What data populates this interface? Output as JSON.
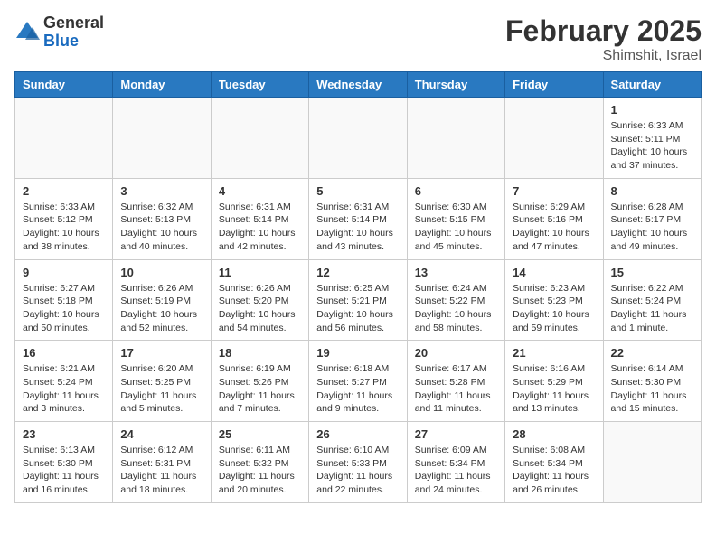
{
  "header": {
    "logo_general": "General",
    "logo_blue": "Blue",
    "main_title": "February 2025",
    "subtitle": "Shimshit, Israel"
  },
  "weekdays": [
    "Sunday",
    "Monday",
    "Tuesday",
    "Wednesday",
    "Thursday",
    "Friday",
    "Saturday"
  ],
  "weeks": [
    [
      {
        "day": "",
        "info": ""
      },
      {
        "day": "",
        "info": ""
      },
      {
        "day": "",
        "info": ""
      },
      {
        "day": "",
        "info": ""
      },
      {
        "day": "",
        "info": ""
      },
      {
        "day": "",
        "info": ""
      },
      {
        "day": "1",
        "info": "Sunrise: 6:33 AM\nSunset: 5:11 PM\nDaylight: 10 hours\nand 37 minutes."
      }
    ],
    [
      {
        "day": "2",
        "info": "Sunrise: 6:33 AM\nSunset: 5:12 PM\nDaylight: 10 hours\nand 38 minutes."
      },
      {
        "day": "3",
        "info": "Sunrise: 6:32 AM\nSunset: 5:13 PM\nDaylight: 10 hours\nand 40 minutes."
      },
      {
        "day": "4",
        "info": "Sunrise: 6:31 AM\nSunset: 5:14 PM\nDaylight: 10 hours\nand 42 minutes."
      },
      {
        "day": "5",
        "info": "Sunrise: 6:31 AM\nSunset: 5:14 PM\nDaylight: 10 hours\nand 43 minutes."
      },
      {
        "day": "6",
        "info": "Sunrise: 6:30 AM\nSunset: 5:15 PM\nDaylight: 10 hours\nand 45 minutes."
      },
      {
        "day": "7",
        "info": "Sunrise: 6:29 AM\nSunset: 5:16 PM\nDaylight: 10 hours\nand 47 minutes."
      },
      {
        "day": "8",
        "info": "Sunrise: 6:28 AM\nSunset: 5:17 PM\nDaylight: 10 hours\nand 49 minutes."
      }
    ],
    [
      {
        "day": "9",
        "info": "Sunrise: 6:27 AM\nSunset: 5:18 PM\nDaylight: 10 hours\nand 50 minutes."
      },
      {
        "day": "10",
        "info": "Sunrise: 6:26 AM\nSunset: 5:19 PM\nDaylight: 10 hours\nand 52 minutes."
      },
      {
        "day": "11",
        "info": "Sunrise: 6:26 AM\nSunset: 5:20 PM\nDaylight: 10 hours\nand 54 minutes."
      },
      {
        "day": "12",
        "info": "Sunrise: 6:25 AM\nSunset: 5:21 PM\nDaylight: 10 hours\nand 56 minutes."
      },
      {
        "day": "13",
        "info": "Sunrise: 6:24 AM\nSunset: 5:22 PM\nDaylight: 10 hours\nand 58 minutes."
      },
      {
        "day": "14",
        "info": "Sunrise: 6:23 AM\nSunset: 5:23 PM\nDaylight: 10 hours\nand 59 minutes."
      },
      {
        "day": "15",
        "info": "Sunrise: 6:22 AM\nSunset: 5:24 PM\nDaylight: 11 hours\nand 1 minute."
      }
    ],
    [
      {
        "day": "16",
        "info": "Sunrise: 6:21 AM\nSunset: 5:24 PM\nDaylight: 11 hours\nand 3 minutes."
      },
      {
        "day": "17",
        "info": "Sunrise: 6:20 AM\nSunset: 5:25 PM\nDaylight: 11 hours\nand 5 minutes."
      },
      {
        "day": "18",
        "info": "Sunrise: 6:19 AM\nSunset: 5:26 PM\nDaylight: 11 hours\nand 7 minutes."
      },
      {
        "day": "19",
        "info": "Sunrise: 6:18 AM\nSunset: 5:27 PM\nDaylight: 11 hours\nand 9 minutes."
      },
      {
        "day": "20",
        "info": "Sunrise: 6:17 AM\nSunset: 5:28 PM\nDaylight: 11 hours\nand 11 minutes."
      },
      {
        "day": "21",
        "info": "Sunrise: 6:16 AM\nSunset: 5:29 PM\nDaylight: 11 hours\nand 13 minutes."
      },
      {
        "day": "22",
        "info": "Sunrise: 6:14 AM\nSunset: 5:30 PM\nDaylight: 11 hours\nand 15 minutes."
      }
    ],
    [
      {
        "day": "23",
        "info": "Sunrise: 6:13 AM\nSunset: 5:30 PM\nDaylight: 11 hours\nand 16 minutes."
      },
      {
        "day": "24",
        "info": "Sunrise: 6:12 AM\nSunset: 5:31 PM\nDaylight: 11 hours\nand 18 minutes."
      },
      {
        "day": "25",
        "info": "Sunrise: 6:11 AM\nSunset: 5:32 PM\nDaylight: 11 hours\nand 20 minutes."
      },
      {
        "day": "26",
        "info": "Sunrise: 6:10 AM\nSunset: 5:33 PM\nDaylight: 11 hours\nand 22 minutes."
      },
      {
        "day": "27",
        "info": "Sunrise: 6:09 AM\nSunset: 5:34 PM\nDaylight: 11 hours\nand 24 minutes."
      },
      {
        "day": "28",
        "info": "Sunrise: 6:08 AM\nSunset: 5:34 PM\nDaylight: 11 hours\nand 26 minutes."
      },
      {
        "day": "",
        "info": ""
      }
    ]
  ]
}
